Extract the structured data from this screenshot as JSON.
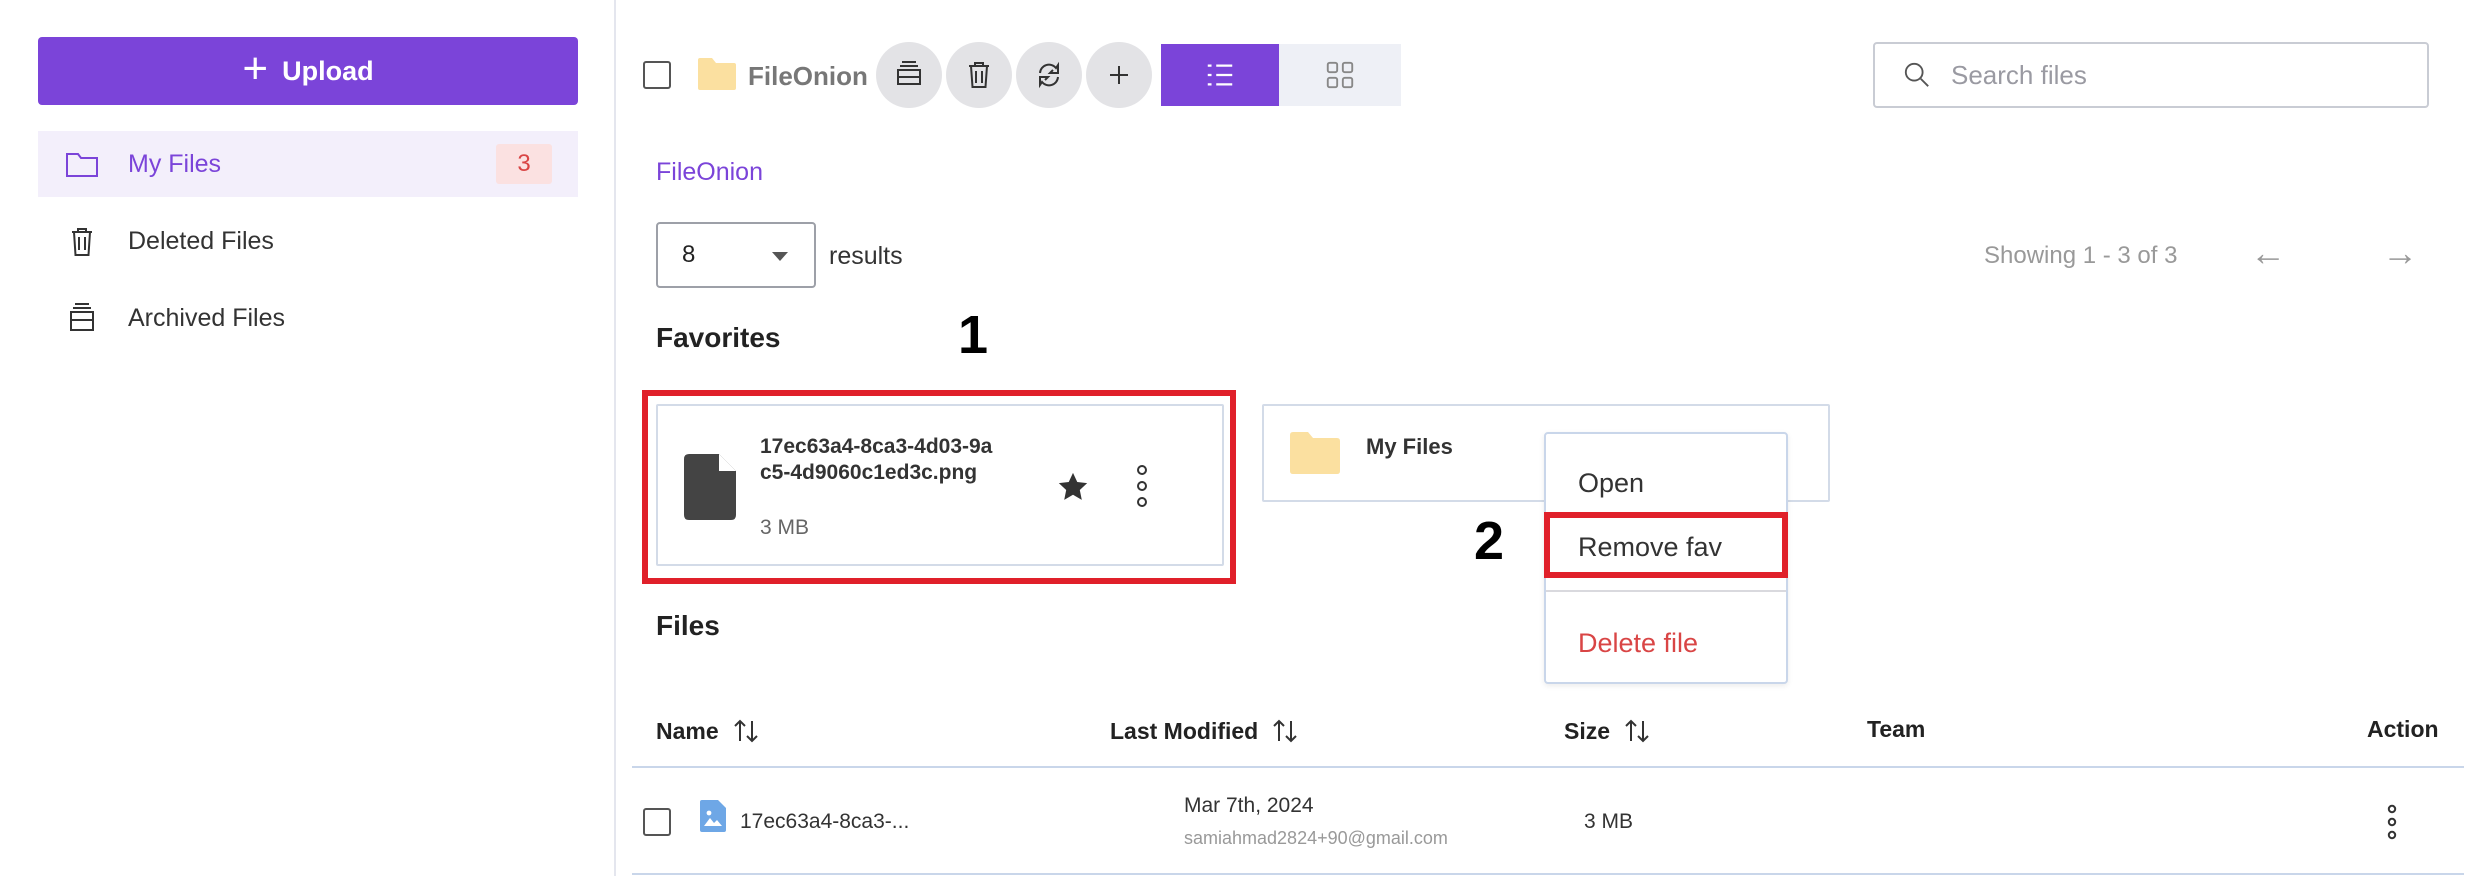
{
  "sidebar": {
    "upload_label": "Upload",
    "items": [
      {
        "label": "My Files",
        "badge": "3",
        "icon": "folder-icon",
        "active": true
      },
      {
        "label": "Deleted Files",
        "icon": "trash-icon"
      },
      {
        "label": "Archived Files",
        "icon": "archive-icon"
      }
    ]
  },
  "toolbar": {
    "folder_name": "FileOnion",
    "search_placeholder": "Search files"
  },
  "breadcrumb": "FileOnion",
  "pagination": {
    "per_page": "8",
    "results_label": "results",
    "showing": "Showing 1 - 3 of 3",
    "prev_arrow": "←",
    "next_arrow": "→"
  },
  "favorites": {
    "title": "Favorites",
    "file_card": {
      "name": "17ec63a4-8ca3-4d03-9ac5-4d9060c1ed3c.png",
      "size": "3 MB"
    },
    "folder_card": {
      "name": "My Files"
    }
  },
  "annotations": {
    "step1": "1",
    "step2": "2"
  },
  "context_menu": {
    "open": "Open",
    "remove_fav": "Remove fav",
    "delete_file": "Delete file"
  },
  "files": {
    "title": "Files",
    "columns": [
      "Name",
      "Last Modified",
      "Size",
      "Team",
      "Action"
    ],
    "rows": [
      {
        "name": "17ec63a4-8ca3-...",
        "modified_date": "Mar 7th, 2024",
        "modified_by": "samiahmad2824+90@gmail.com",
        "size": "3 MB",
        "team": ""
      }
    ]
  },
  "colors": {
    "accent": "#7b44d9",
    "danger": "#d94545",
    "annotation": "#e0202a",
    "folder": "#fbe0a0"
  }
}
